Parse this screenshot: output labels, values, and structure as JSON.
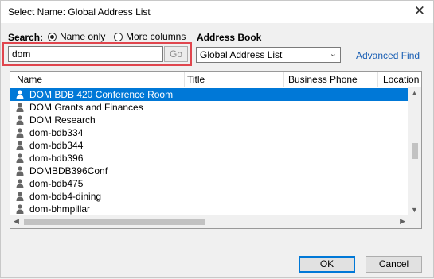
{
  "window": {
    "title": "Select Name: Global Address List",
    "close_glyph": "✕"
  },
  "search": {
    "label": "Search:",
    "option_name_only": "Name only",
    "option_more_columns": "More columns",
    "selected_option": "Name only",
    "value": "dom",
    "go_label": "Go"
  },
  "address_book": {
    "label": "Address Book",
    "selected": "Global Address List",
    "advanced_find": "Advanced Find"
  },
  "list": {
    "columns": [
      "Name",
      "Title",
      "Business Phone",
      "Location"
    ],
    "rows": [
      "DOM BDB 420 Conference Room",
      "DOM Grants and Finances",
      "DOM Research",
      "dom-bdb334",
      "dom-bdb344",
      "dom-bdb396",
      "DOMBDB396Conf",
      "dom-bdb475",
      "dom-bdb4-dining",
      "dom-bhmpillar"
    ],
    "selected_index": 0,
    "row_icon": "person-icon"
  },
  "buttons": {
    "ok": "OK",
    "cancel": "Cancel"
  },
  "colors": {
    "selection": "#0078d7",
    "highlight_border": "#e0464e",
    "link": "#1a5fb4"
  }
}
